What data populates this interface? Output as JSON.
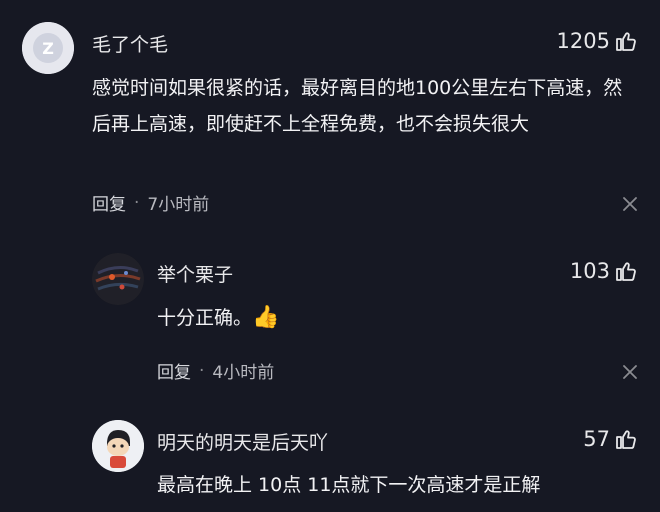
{
  "comments": [
    {
      "username": "毛了个毛",
      "likes": "1205",
      "text": "感觉时间如果很紧的话，最好离目的地100公里左右下高速，然后再上高速，即使赶不上全程免费，也不会损失很大",
      "reply_label": "回复",
      "separator": "·",
      "time": "7小时前",
      "avatar_letter": "Z"
    },
    {
      "username": "举个栗子",
      "likes": "103",
      "text": "十分正确。",
      "emoji": "👍",
      "reply_label": "回复",
      "separator": "·",
      "time": "4小时前"
    },
    {
      "username": "明天的明天是后天吖",
      "likes": "57",
      "text": "最高在晚上 10点 11点就下一次高速才是正解"
    }
  ],
  "icons": {
    "like": "thumbs-up-icon",
    "close": "close-icon"
  },
  "colors": {
    "background": "#161823",
    "secondary_text": "#b9bac0"
  }
}
